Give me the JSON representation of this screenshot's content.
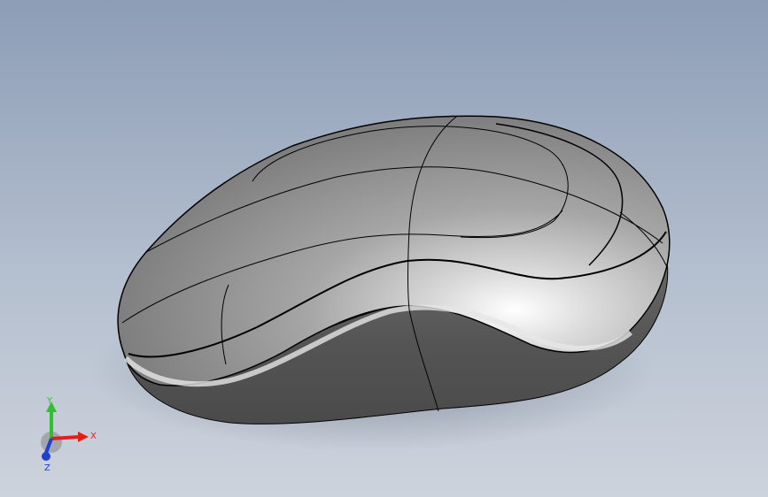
{
  "viewport": {
    "background_top": "#8d9db6",
    "background_bottom": "#cdd3dc"
  },
  "model": {
    "object": "computer-mouse-surface-model",
    "edge_color": "#000000"
  },
  "triad": {
    "x_label": "X",
    "y_label": "Y",
    "z_label": "Z",
    "x_color": "#e0201a",
    "y_color": "#2fbf2f",
    "z_color": "#2040d0"
  }
}
